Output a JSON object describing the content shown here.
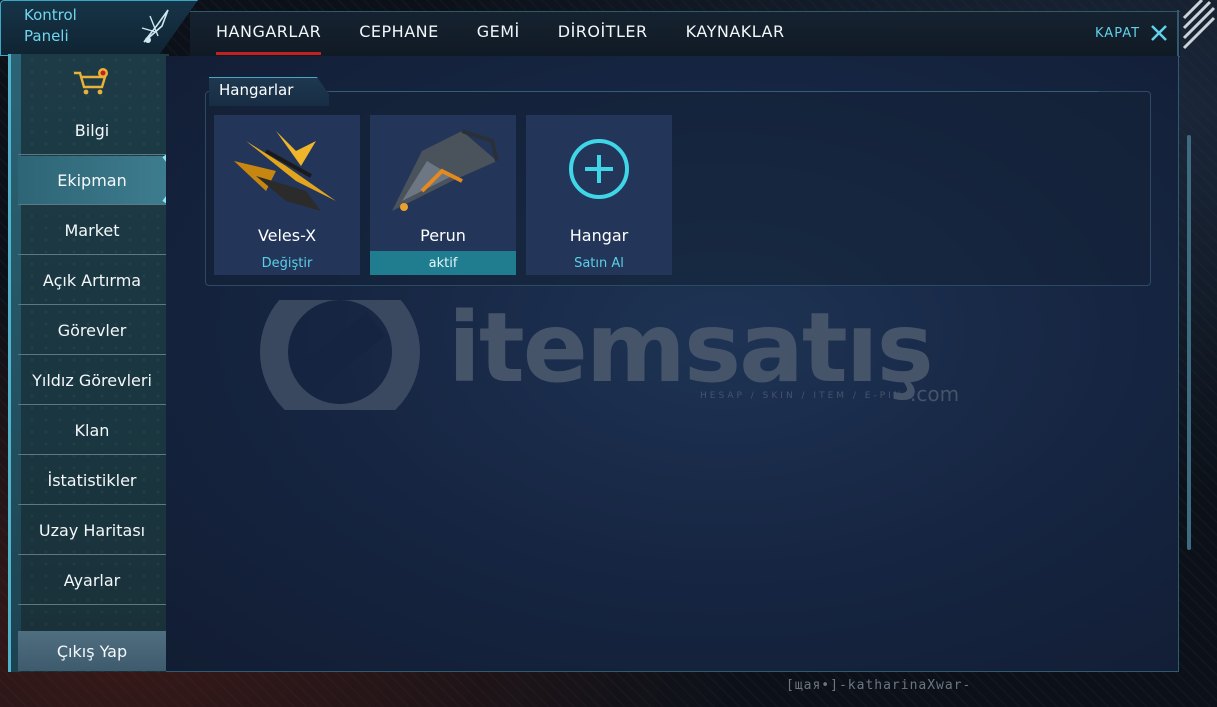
{
  "window": {
    "title": "Kontrol Paneli",
    "title_line1": "Kontrol",
    "title_line2": "Paneli"
  },
  "tabs": [
    {
      "label": "HANGARLAR",
      "active": true
    },
    {
      "label": "CEPHANE",
      "active": false
    },
    {
      "label": "GEMİ",
      "active": false
    },
    {
      "label": "DİROİTLER",
      "active": false
    },
    {
      "label": "KAYNAKLAR",
      "active": false
    }
  ],
  "close": {
    "label": "KAPAT",
    "icon": "close-icon"
  },
  "sidebar": {
    "cart_icon": "shop-cart-icon",
    "items": [
      {
        "label": "Bilgi",
        "active": false
      },
      {
        "label": "Ekipman",
        "active": true
      },
      {
        "label": "Market",
        "active": false
      },
      {
        "label": "Açık Artırma",
        "active": false
      },
      {
        "label": "Görevler",
        "active": false
      },
      {
        "label": "Yıldız Görevleri",
        "active": false
      },
      {
        "label": "Klan",
        "active": false
      },
      {
        "label": "İstatistikler",
        "active": false
      },
      {
        "label": "Uzay Haritası",
        "active": false
      },
      {
        "label": "Ayarlar",
        "active": false
      }
    ],
    "exit_label": "Çıkış Yap"
  },
  "section": {
    "title": "Hangarlar"
  },
  "hangars": [
    {
      "name": "Veles-X",
      "action": "Değiştir",
      "active": false,
      "icon": "ship-veles-x-icon"
    },
    {
      "name": "Perun",
      "action": "aktif",
      "active": true,
      "icon": "ship-perun-icon"
    },
    {
      "name": "Hangar",
      "action": "Satın Al",
      "active": false,
      "icon": "add-circle-icon"
    }
  ],
  "watermark": {
    "text": "itemsatış",
    "sub": "HESAP / SKIN / ITEM / E-PIN",
    "domain": ".com"
  },
  "footer": {
    "player_name": "[щая•]-katharinaXwar-"
  },
  "colors": {
    "accent": "#5fd1ea",
    "active_tab_underline": "#c32021",
    "active_card": "#1f7d8f"
  }
}
